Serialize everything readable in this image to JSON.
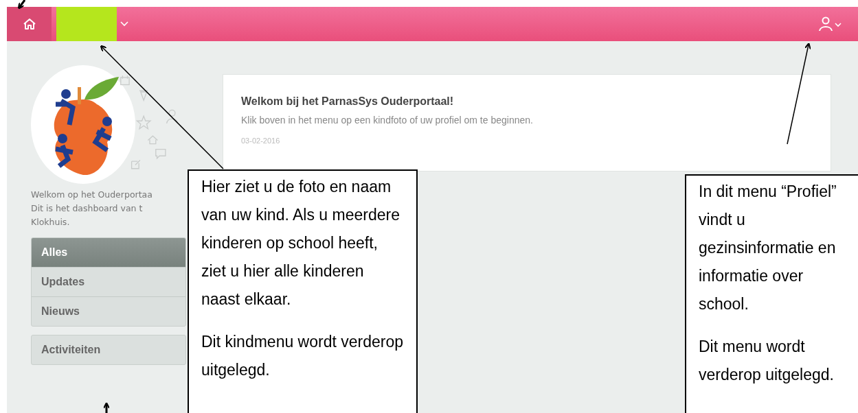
{
  "topbar": {
    "child_menu": {
      "expanded": false
    },
    "profile_menu": {
      "expanded": false
    }
  },
  "sidebar": {
    "intro_lines": [
      "Welkom op het Ouderportaa",
      "Dit is het dashboard van t",
      "Klokhuis."
    ],
    "menu_groups": [
      [
        {
          "label": "Alles",
          "selected": true
        },
        {
          "label": "Updates",
          "selected": false
        },
        {
          "label": "Nieuws",
          "selected": false
        }
      ],
      [
        {
          "label": "Activiteiten",
          "selected": false
        }
      ]
    ]
  },
  "message_card": {
    "title": "Welkom bij het ParnasSys Ouderportaal!",
    "text": "Klik boven in het menu op een kindfoto of uw profiel om te beginnen.",
    "date": "03-02-2016"
  },
  "callouts": [
    {
      "paragraphs": [
        "Hier ziet u de foto en naam van uw kind. Als u meerdere kinderen op school heeft, ziet u hier alle kinderen naast elkaar.",
        "Dit kindmenu wordt verderop uitgelegd."
      ]
    },
    {
      "paragraphs": [
        "In dit menu “Profiel” vindt u gezinsinformatie en informatie over school.",
        "Dit menu wordt verderop uitgelegd."
      ]
    }
  ]
}
